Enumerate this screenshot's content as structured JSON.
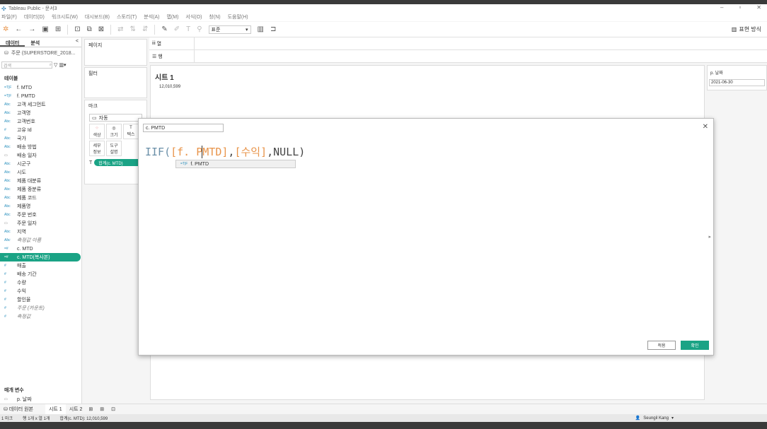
{
  "app": {
    "title": "Tableau Public - 문서3"
  },
  "menu": [
    "파일(F)",
    "데이터(D)",
    "워크시트(W)",
    "대시보드(B)",
    "스토리(T)",
    "분석(A)",
    "맵(M)",
    "서식(O)",
    "창(N)",
    "도움말(H)"
  ],
  "toolbar": {
    "format_select": "표준",
    "show_me": "표현 방식"
  },
  "left": {
    "tab_data": "데이터",
    "tab_analysis": "분석",
    "collapse": "<",
    "datasource": "주문 (SUPERSTORE_2018...",
    "search_placeholder": "검색",
    "tables_title": "테이블",
    "fields": [
      {
        "icon": "=T|F",
        "label": "f. MTD"
      },
      {
        "icon": "=T|F",
        "label": "f. PMTD"
      },
      {
        "icon": "Abc",
        "label": "고객 세그먼트"
      },
      {
        "icon": "Abc",
        "label": "고객명"
      },
      {
        "icon": "Abc",
        "label": "고객번호"
      },
      {
        "icon": "#",
        "label": "고유 Id"
      },
      {
        "icon": "Abc",
        "label": "국가"
      },
      {
        "icon": "Abc",
        "label": "배송 방법"
      },
      {
        "icon": "▭",
        "label": "배송 일자"
      },
      {
        "icon": "Abc",
        "label": "시군구"
      },
      {
        "icon": "Abc",
        "label": "시도"
      },
      {
        "icon": "Abc",
        "label": "제품 대분류"
      },
      {
        "icon": "Abc",
        "label": "제품 중분류"
      },
      {
        "icon": "Abc",
        "label": "제품 코드"
      },
      {
        "icon": "Abc",
        "label": "제품명"
      },
      {
        "icon": "Abc",
        "label": "주문 번호"
      },
      {
        "icon": "▭",
        "label": "주문 일자"
      },
      {
        "icon": "Abc",
        "label": "지역"
      },
      {
        "icon": "Abc",
        "label": "측정값 이름"
      },
      {
        "icon": "=#",
        "label": "c. MTD"
      },
      {
        "icon": "=#",
        "label": "c. MTD(복사본)"
      },
      {
        "icon": "#",
        "label": "매출"
      },
      {
        "icon": "#",
        "label": "배송 기간"
      },
      {
        "icon": "#",
        "label": "수량"
      },
      {
        "icon": "#",
        "label": "수익"
      },
      {
        "icon": "#",
        "label": "할인율"
      },
      {
        "icon": "#",
        "label": "주문 (카운트)"
      },
      {
        "icon": "#",
        "label": "측정값"
      }
    ],
    "params_title": "매개 변수",
    "param_item": "p. 날짜"
  },
  "shelves": {
    "pages": "페이지",
    "filters": "필터",
    "marks": "마크",
    "marks_type": "자동",
    "btn_color": "색상",
    "btn_size": "크기",
    "btn_text": "텍스",
    "btn_detail": "세부\n정보",
    "btn_tooltip": "도구\n설명",
    "pill": "합계(c. MTD)"
  },
  "rows_cols": {
    "columns": "열",
    "rows": "행"
  },
  "viz": {
    "sheet_title": "시트 1",
    "value": "12,010,599"
  },
  "param_card": {
    "title": "p. 날짜",
    "value": "2021-06-30"
  },
  "dialog": {
    "calc_name": "c. PMTD",
    "formula": {
      "p1": "IIF(",
      "p2": "[f. P",
      "p3": "MTD]",
      "p4": ",",
      "p5": "[수익]",
      "p6": ",NULL)"
    },
    "autocomplete": "f. PMTD",
    "ac_icon": "=T|F",
    "apply": "적용",
    "ok": "확인"
  },
  "sheetbar": {
    "datasource": "데이터 원본",
    "sheet1": "시트 1",
    "sheet2": "시트 2"
  },
  "status": {
    "marks": "1 마크",
    "rows": "행 1개 x 열 1개",
    "sum": "합계(c. MTD): 12,010,599",
    "user": "Seungil Kang"
  }
}
